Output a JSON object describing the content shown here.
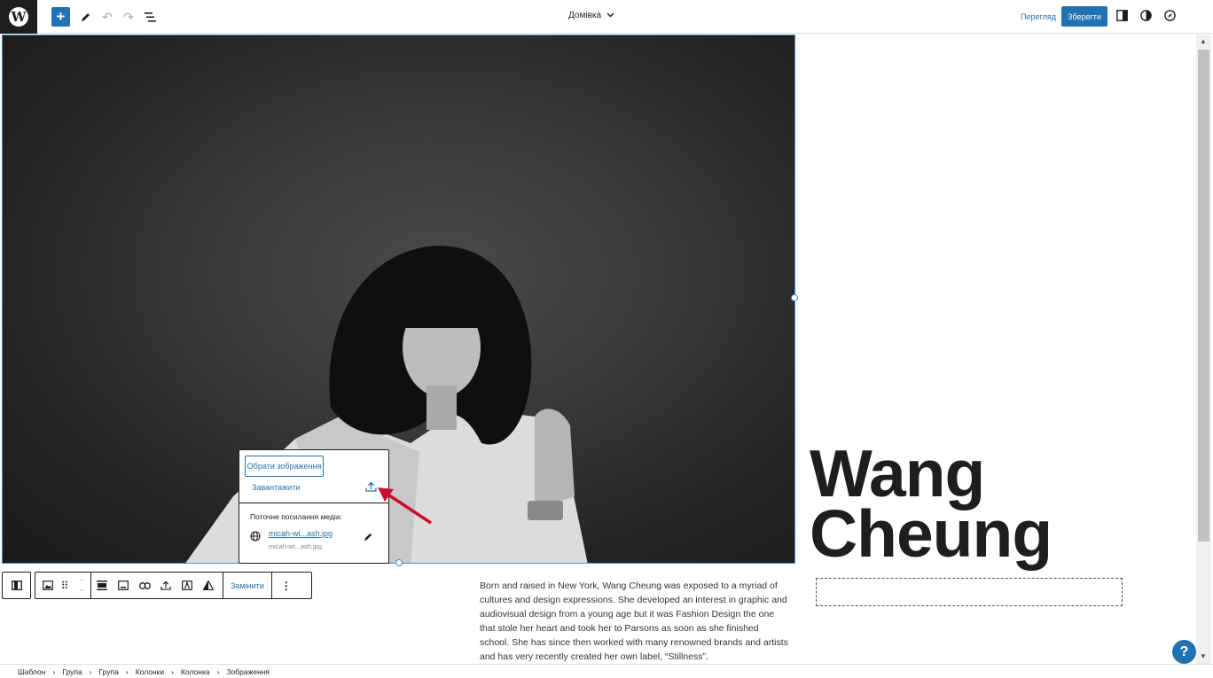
{
  "topbar": {
    "add_icon": "plus-icon",
    "document_title": "Домівка",
    "preview_label": "Перегляд",
    "save_label": "Зберегти"
  },
  "canvas": {
    "heading_line1": "Wang",
    "heading_line2": "Cheung",
    "bio": "Born and raised in New York, Wang Cheung was exposed to a myriad of cultures and design expressions. She developed an interest in graphic and audiovisual design from a young age but it was Fashion Design the one that stole her heart and took her to Parsons as soon as she finished school. She has since then worked with many renowned brands and artists and has very recently created her own label, “Stillness”."
  },
  "popover": {
    "pick_image_label": "Обрати зображення",
    "upload_label": "Завантажити",
    "current_media_label": "Поточне посилання медіа:",
    "media_link": "micah-wi...ash.jpg",
    "media_subtext": "micah-wi...ash.jpg"
  },
  "block_toolbar": {
    "replace_label": "Замінити"
  },
  "breadcrumb": [
    "Шаблон",
    "Група",
    "Група",
    "Колонки",
    "Колонка",
    "Зображення"
  ],
  "colors": {
    "accent": "#2271b1",
    "selection": "#3c8fd6",
    "annotation_arrow": "#c8102e"
  }
}
